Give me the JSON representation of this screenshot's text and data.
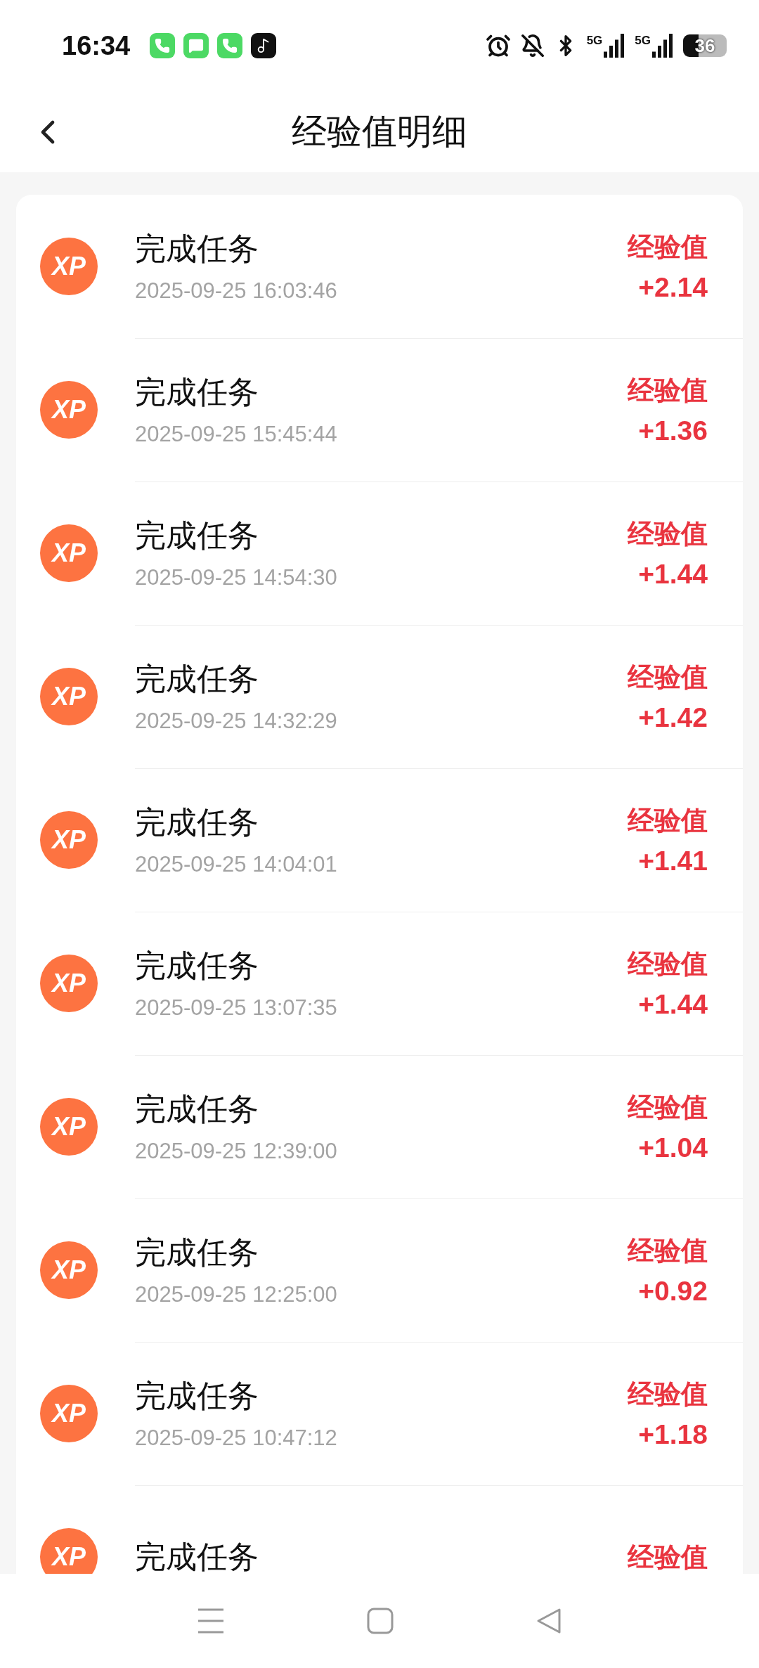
{
  "status_bar": {
    "time": "16:34",
    "apps": [
      {
        "kind": "phone"
      },
      {
        "kind": "message"
      },
      {
        "kind": "phone"
      },
      {
        "kind": "music"
      }
    ],
    "network": [
      "5G",
      "5G"
    ],
    "battery": "36"
  },
  "header": {
    "title": "经验值明细"
  },
  "records": [
    {
      "badge": "XP",
      "title": "完成任务",
      "time": "2025-09-25 16:03:46",
      "label": "经验值",
      "value": "+2.14"
    },
    {
      "badge": "XP",
      "title": "完成任务",
      "time": "2025-09-25 15:45:44",
      "label": "经验值",
      "value": "+1.36"
    },
    {
      "badge": "XP",
      "title": "完成任务",
      "time": "2025-09-25 14:54:30",
      "label": "经验值",
      "value": "+1.44"
    },
    {
      "badge": "XP",
      "title": "完成任务",
      "time": "2025-09-25 14:32:29",
      "label": "经验值",
      "value": "+1.42"
    },
    {
      "badge": "XP",
      "title": "完成任务",
      "time": "2025-09-25 14:04:01",
      "label": "经验值",
      "value": "+1.41"
    },
    {
      "badge": "XP",
      "title": "完成任务",
      "time": "2025-09-25 13:07:35",
      "label": "经验值",
      "value": "+1.44"
    },
    {
      "badge": "XP",
      "title": "完成任务",
      "time": "2025-09-25 12:39:00",
      "label": "经验值",
      "value": "+1.04"
    },
    {
      "badge": "XP",
      "title": "完成任务",
      "time": "2025-09-25 12:25:00",
      "label": "经验值",
      "value": "+0.92"
    },
    {
      "badge": "XP",
      "title": "完成任务",
      "time": "2025-09-25 10:47:12",
      "label": "经验值",
      "value": "+1.18"
    },
    {
      "badge": "XP",
      "title": "完成任务",
      "label": "经验值"
    }
  ]
}
